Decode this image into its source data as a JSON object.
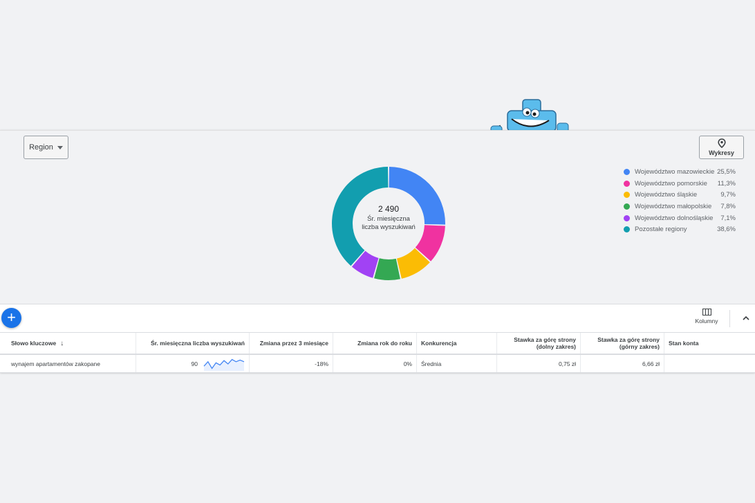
{
  "filters": {
    "region_label": "Region",
    "charts_label": "Wykresy"
  },
  "icons": {
    "region_caret": "caret-down-icon",
    "charts": "map-pin-icon",
    "add": "plus-icon",
    "columns": "columns-icon",
    "collapse": "chevron-up-icon",
    "sort": "arrow-down-icon"
  },
  "chart_data": {
    "type": "pie",
    "center_value": "2 490",
    "center_label": "Śr. miesięczna liczba wyszukiwań",
    "slices": [
      {
        "name": "Województwo mazowieckie",
        "label": "25,5%",
        "value": 25.5,
        "color": "#4285f4"
      },
      {
        "name": "Województwo pomorskie",
        "label": "11,3%",
        "value": 11.3,
        "color": "#f032a0"
      },
      {
        "name": "Województwo śląskie",
        "label": "9,7%",
        "value": 9.7,
        "color": "#fbbc04"
      },
      {
        "name": "Województwo małopolskie",
        "label": "7,8%",
        "value": 7.8,
        "color": "#34a853"
      },
      {
        "name": "Województwo dolnośląskie",
        "label": "7,1%",
        "value": 7.1,
        "color": "#a142f4"
      },
      {
        "name": "Pozostałe regiony",
        "label": "38,6%",
        "value": 38.6,
        "color": "#129eaf"
      }
    ]
  },
  "toolbar": {
    "add_label": "+",
    "columns_label": "Kolumny"
  },
  "table": {
    "headers": [
      "Słowo kluczowe",
      "Śr. miesięczna liczba wyszukiwań",
      "Zmiana przez 3 miesiące",
      "Zmiana rok do roku",
      "Konkurencja",
      "Stawka za górę strony (dolny zakres)",
      "Stawka za górę strony (górny zakres)",
      "Stan konta"
    ],
    "row": {
      "keyword": "wynajem apartamentów zakopane",
      "searches": "90",
      "change_3m": "-18%",
      "change_yoy": "0%",
      "competition": "Średnia",
      "bid_low": "0,75 zł",
      "bid_high": "6,66 zł",
      "status": "",
      "trend": [
        0.3,
        0.7,
        0.1,
        0.6,
        0.4,
        0.8,
        0.5,
        0.9,
        0.7,
        0.85,
        0.7
      ]
    }
  }
}
